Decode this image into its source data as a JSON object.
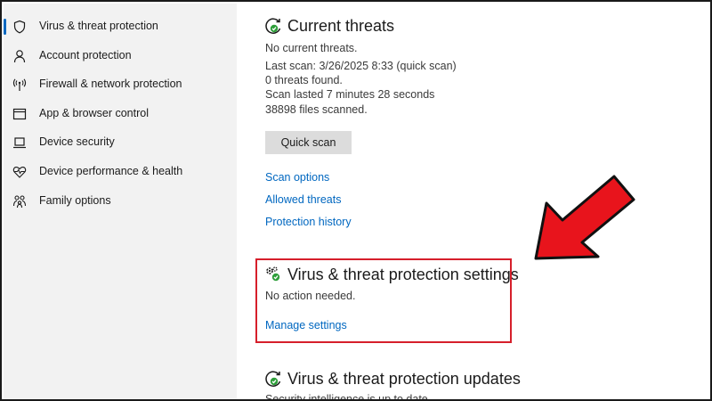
{
  "sidebar": {
    "items": [
      {
        "label": "Virus & threat protection",
        "icon": "shield-icon",
        "selected": true
      },
      {
        "label": "Account protection",
        "icon": "person-icon"
      },
      {
        "label": "Firewall & network protection",
        "icon": "wifi-antenna-icon"
      },
      {
        "label": "App & browser control",
        "icon": "browser-window-icon"
      },
      {
        "label": "Device security",
        "icon": "laptop-icon"
      },
      {
        "label": "Device performance & health",
        "icon": "heart-pulse-icon"
      },
      {
        "label": "Family options",
        "icon": "family-icon"
      }
    ]
  },
  "current_threats": {
    "title": "Current threats",
    "icon": "scan-refresh-icon",
    "lines": [
      "No current threats.",
      "Last scan: 3/26/2025 8:33 (quick scan)",
      "0 threats found.",
      "Scan lasted 7 minutes 28 seconds",
      "38898 files scanned."
    ],
    "quick_scan_label": "Quick scan",
    "links": [
      "Scan options",
      "Allowed threats",
      "Protection history"
    ]
  },
  "protection_settings": {
    "title": "Virus & threat protection settings",
    "icon": "settings-gears-check-icon",
    "status": "No action needed.",
    "link": "Manage settings"
  },
  "protection_updates": {
    "title": "Virus & threat protection updates",
    "icon": "update-refresh-icon",
    "status": "Security intelligence is up to date."
  },
  "colors": {
    "accent": "#0067c0",
    "highlight": "#d61f2b",
    "arrow_fill": "#e8141c",
    "ok_green": "#2e9e3a"
  }
}
